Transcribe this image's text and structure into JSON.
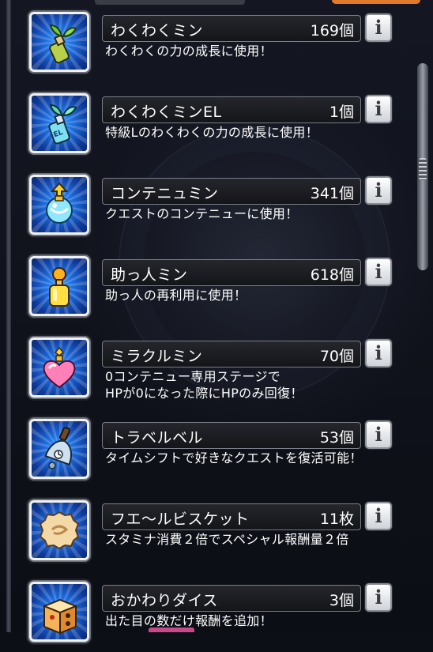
{
  "items": [
    {
      "name": "わくわくミン",
      "count": "169個",
      "desc": "わくわくの力の成長に使用！",
      "icon": "bottle-sprout-icon"
    },
    {
      "name": "わくわくミンEL",
      "count": "1個",
      "desc": "特級Lのわくわくの力の成長に使用！",
      "icon": "el-bottle-icon"
    },
    {
      "name": "コンテニュミン",
      "count": "341個",
      "desc": "クエストのコンテニューに使用！",
      "icon": "continue-potion-icon"
    },
    {
      "name": "助っ人ミン",
      "count": "618個",
      "desc": "助っ人の再利用に使用！",
      "icon": "helper-potion-icon"
    },
    {
      "name": "ミラクルミン",
      "count": "70個",
      "desc": "0コンテニュー専用ステージで\nHPが0になった際にHPのみ回復！",
      "icon": "heart-potion-icon"
    },
    {
      "name": "トラベルベル",
      "count": "53個",
      "desc": "タイムシフトで好きなクエストを復活可能！",
      "icon": "bell-icon"
    },
    {
      "name": "フエ～ルビスケット",
      "count": "11枚",
      "desc": "スタミナ消費２倍でスペシャル報酬量２倍",
      "icon": "biscuit-icon"
    },
    {
      "name": "おかわりダイス",
      "count": "3個",
      "desc": "出た目の数だけ報酬を追加！",
      "icon": "dice-icon"
    }
  ],
  "info_label": "i",
  "colors": {
    "tile_blue": "#1f6fe0",
    "background": "#0d0f17",
    "accent_orange": "#e07a2a"
  }
}
